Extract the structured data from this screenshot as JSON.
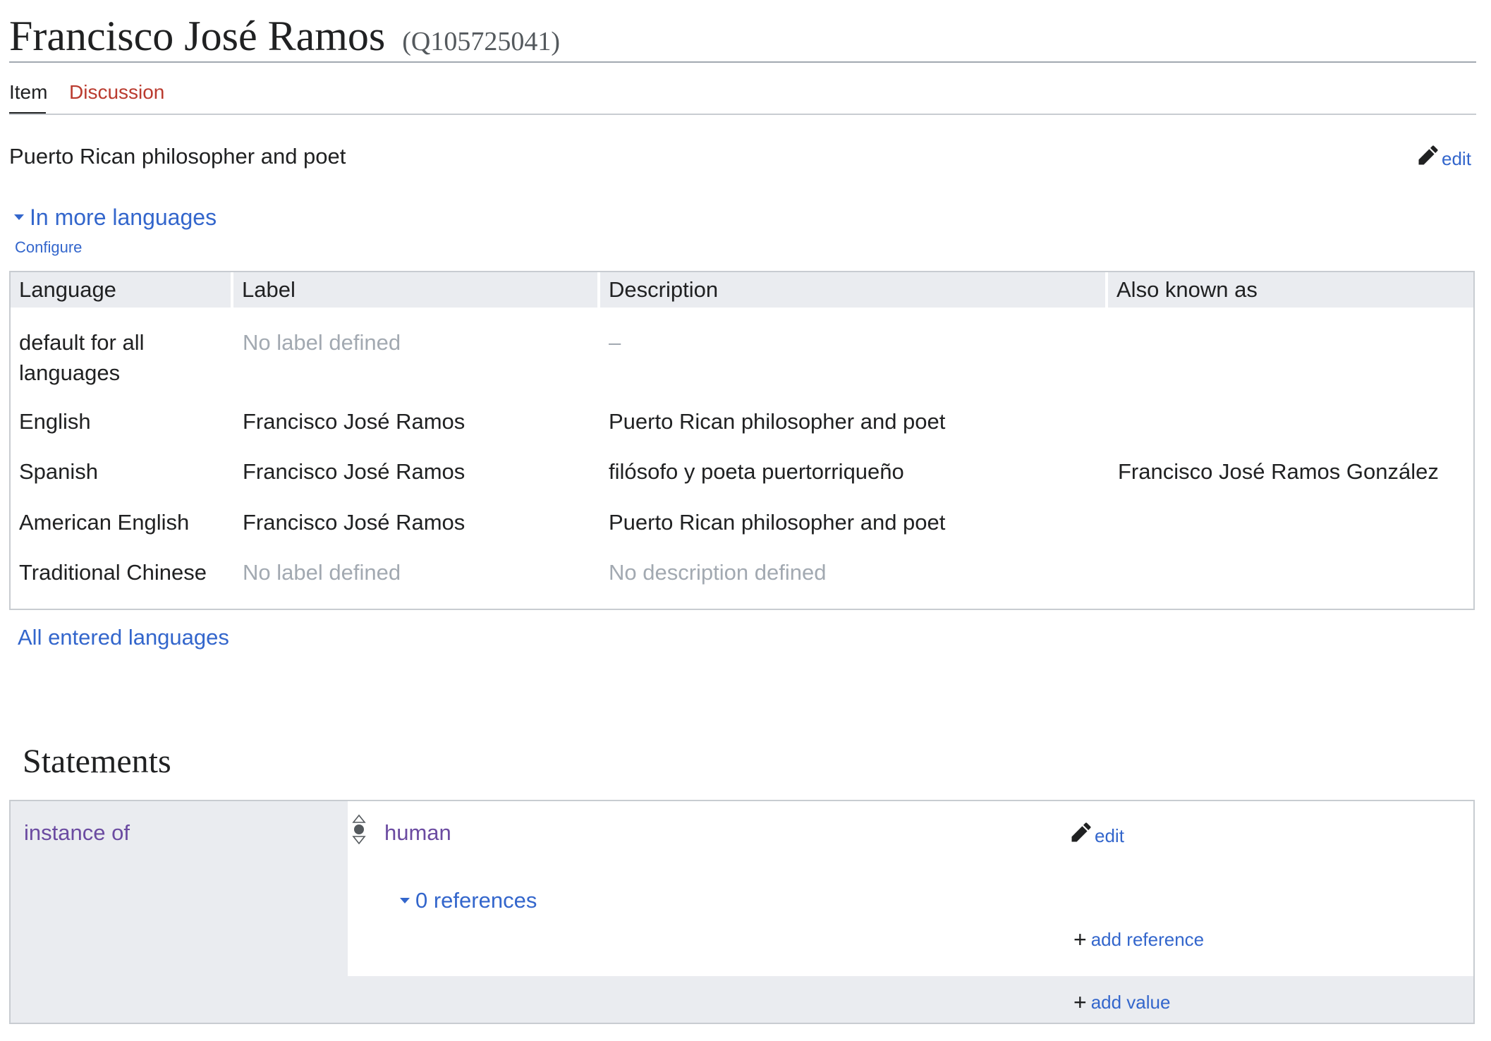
{
  "header": {
    "title": "Francisco José Ramos",
    "qid": "(Q105725041)"
  },
  "tabs": {
    "item": "Item",
    "discussion": "Discussion"
  },
  "description": "Puerto Rican philosopher and poet",
  "edit_label": "edit",
  "languages": {
    "toggle": "In more languages",
    "configure": "Configure",
    "columns": [
      "Language",
      "Label",
      "Description",
      "Also known as"
    ],
    "rows": [
      {
        "language": "default for all languages",
        "label": "No label defined",
        "description": "–",
        "aliases": ""
      },
      {
        "language": "English",
        "label": "Francisco José Ramos",
        "description": "Puerto Rican philosopher and poet",
        "aliases": ""
      },
      {
        "language": "Spanish",
        "label": "Francisco José Ramos",
        "description": "filósofo y poeta puertorriqueño",
        "aliases": "Francisco José Ramos González"
      },
      {
        "language": "American English",
        "label": "Francisco José Ramos",
        "description": "Puerto Rican philosopher and poet",
        "aliases": ""
      },
      {
        "language": "Traditional Chinese",
        "label": "No label defined",
        "description": "No description defined",
        "aliases": ""
      }
    ],
    "all_entered": "All entered languages"
  },
  "statements": {
    "heading": "Statements",
    "property": "instance of",
    "value": "human",
    "edit_label": "edit",
    "references_toggle": "0 references",
    "add_reference": "add reference",
    "add_value": "add value"
  },
  "colors": {
    "link": "#3366cc",
    "visited_link": "#6b4ba1",
    "new_link": "#ba3b2f",
    "placeholder": "#a2a9b1",
    "table_header_bg": "#eaecf0",
    "border": "#c8ccd1"
  },
  "icons": [
    "pencil-icon",
    "triangle-down-icon",
    "rank-selector-icon",
    "plus-icon"
  ]
}
